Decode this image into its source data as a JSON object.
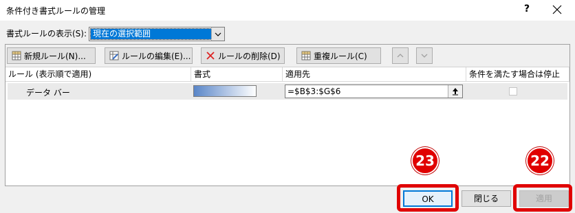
{
  "window": {
    "title": "条件付き書式ルールの管理",
    "help_glyph": "?",
    "close_glyph": "✕"
  },
  "show_rules": {
    "label": "書式ルールの表示(S):",
    "value": "現在の選択範囲"
  },
  "toolbar": {
    "new_rule": "新規ルール(N)...",
    "edit_rule": "ルールの編集(E)...",
    "delete_rule": "ルールの削除(D)",
    "duplicate_rule": "重複ルール(C)",
    "move_up_glyph": "∧",
    "move_down_glyph": "∨"
  },
  "columns": [
    "ルール (表示順で適用)",
    "書式",
    "適用先",
    "条件を満たす場合は停止"
  ],
  "rules": [
    {
      "name": "データ バー",
      "applies_to": "=$B$3:$G$6",
      "stop_if_true": false
    }
  ],
  "buttons": {
    "ok": "OK",
    "close": "閉じる",
    "apply": "適用"
  },
  "annotations": {
    "badge_ok": "23",
    "badge_apply": "22",
    "highlight_color": "#e00000"
  }
}
